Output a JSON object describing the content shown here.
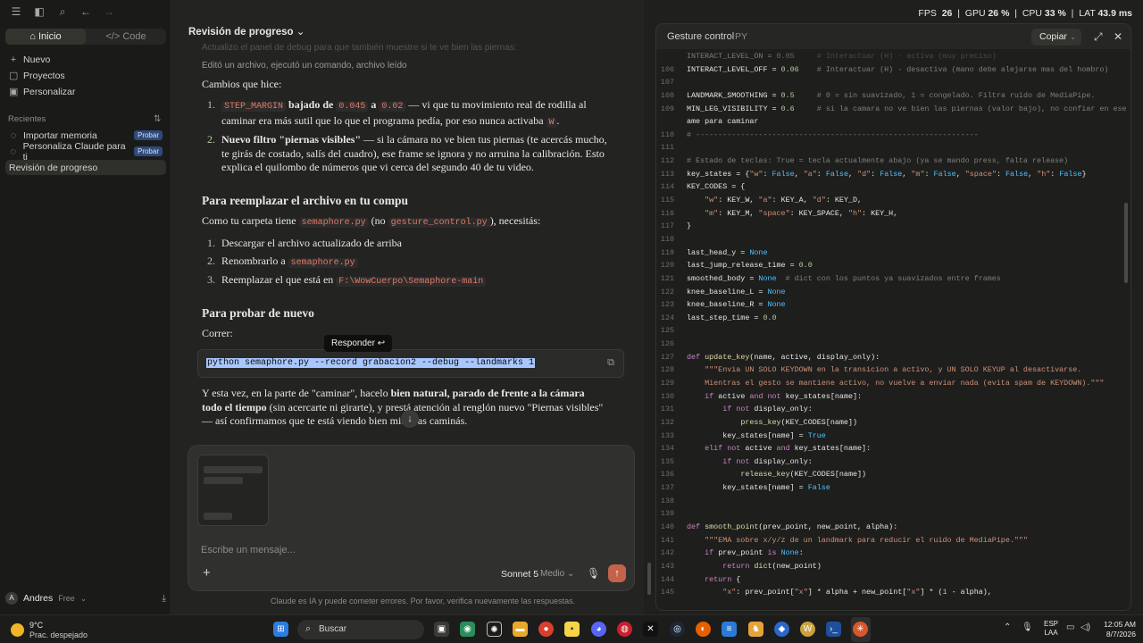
{
  "sidebar": {
    "modes": [
      "Inicio",
      "Code"
    ],
    "nav": [
      {
        "label": "Nuevo",
        "icon": "+"
      },
      {
        "label": "Proyectos",
        "icon": "▢"
      },
      {
        "label": "Personalizar",
        "icon": "▣"
      }
    ],
    "recents_title": "Recientes",
    "recents": [
      {
        "label": "Importar memoria",
        "badge": "Probar"
      },
      {
        "label": "Personaliza Claude para ti",
        "badge": "Probar"
      },
      {
        "label": "Revisión de progreso",
        "badge": ""
      }
    ],
    "user": {
      "initial": "A",
      "name": "Andres",
      "plan": "Free"
    }
  },
  "chat": {
    "title": "Revisión de progreso",
    "faded_top": "Actualizo el panel de debug para que también muestre si te ve bien las piernas:",
    "meta": "Editó un archivo, ejecutó un comando, archivo leído",
    "changes_heading": "Cambios que hice:",
    "change1": {
      "code1": "STEP_MARGIN",
      "b1": "bajado de",
      "code2": "0.045",
      "a": "a",
      "code3": "0.02",
      "rest": "— vi que tu movimiento real de rodilla al caminar era más sutil que lo que el programa pedía, por eso nunca activaba",
      "code4": "W",
      "end": "."
    },
    "change2": {
      "bold": "Nuevo filtro \"piernas visibles\"",
      "rest": "— si la cámara no ve bien tus piernas (te acercás mucho, te girás de costado, salís del cuadro), ese frame se ignora y no arruina la calibración. Esto explica el quilombo de números que vi cerca del segundo 40 de tu video."
    },
    "replace_heading": "Para reemplazar el archivo en tu compu",
    "replace_intro_a": "Como tu carpeta tiene",
    "replace_code1": "semaphore.py",
    "replace_intro_b": "(no",
    "replace_code2": "gesture_control.py",
    "replace_intro_c": "), necesitás:",
    "steps": [
      {
        "text": "Descargar el archivo actualizado de arriba",
        "code": "",
        "tail": ""
      },
      {
        "text": "Renombrarlo a",
        "code": "semaphore.py",
        "tail": ""
      },
      {
        "text": "Reemplazar el que está en",
        "code": "F:\\WowCuerpo\\Semaphore-main",
        "tail": ""
      }
    ],
    "test_heading": "Para probar de nuevo",
    "run_label": "Correr:",
    "tooltip": "Responder ↩",
    "command": "python semaphore.py --record grabacion2 --debug --landmarks 1",
    "final_a": "Y esta vez, en la parte de \"caminar\", hacelo",
    "final_bold": "bien natural, parado de frente a la cámara todo el tiempo",
    "final_b": "(sin acercarte ni girarte), y prestá atención al renglón nuevo \"Piernas visibles\" — así confirmamos que te está viendo bien mientras caminás."
  },
  "composer": {
    "placeholder": "Escribe un mensaje...",
    "model": "Sonnet 5",
    "effort": "Medio",
    "disclaimer": "Claude es IA y puede cometer errores. Por favor, verifica nuevamente las respuestas."
  },
  "panel": {
    "title": "Gesture control",
    "lang": "PY",
    "copy_label": "Copiar",
    "lines": [
      {
        "n": "",
        "code": "INTERACT_LEVEL_ON = 0.05     # Interactuar (H) - activa (muy preciso)"
      },
      {
        "n": "106",
        "code": "INTERACT_LEVEL_OFF = 0.06    # Interactuar (H) - desactiva (mano debe alejarse mas del hombro)"
      },
      {
        "n": "107",
        "code": ""
      },
      {
        "n": "108",
        "code": "LANDMARK_SMOOTHING = 0.5     # 0 = sin suavizado, 1 = congelado. Filtra ruido de MediaPipe."
      },
      {
        "n": "109",
        "code": "MIN_LEG_VISIBILITY = 0.6     # si la camara no ve bien las piernas (valor bajo), no confiar en ese fr"
      },
      {
        "n": "",
        "code": "ame para caminar"
      },
      {
        "n": "110",
        "code": "# ---------------------------------------------------------------"
      },
      {
        "n": "111",
        "code": ""
      },
      {
        "n": "112",
        "code": "# Estado de teclas: True = tecla actualmente abajo (ya se mando press, falta release)"
      },
      {
        "n": "113",
        "code": "key_states = {\"w\": False, \"a\": False, \"d\": False, \"m\": False, \"space\": False, \"h\": False}"
      },
      {
        "n": "114",
        "code": "KEY_CODES = {"
      },
      {
        "n": "115",
        "code": "    \"w\": KEY_W, \"a\": KEY_A, \"d\": KEY_D,"
      },
      {
        "n": "116",
        "code": "    \"m\": KEY_M, \"space\": KEY_SPACE, \"h\": KEY_H,"
      },
      {
        "n": "117",
        "code": "}"
      },
      {
        "n": "118",
        "code": ""
      },
      {
        "n": "119",
        "code": "last_head_y = None"
      },
      {
        "n": "120",
        "code": "last_jump_release_time = 0.0"
      },
      {
        "n": "121",
        "code": "smoothed_body = None  # dict con los puntos ya suavizados entre frames"
      },
      {
        "n": "122",
        "code": "knee_baseline_L = None"
      },
      {
        "n": "123",
        "code": "knee_baseline_R = None"
      },
      {
        "n": "124",
        "code": "last_step_time = 0.0"
      },
      {
        "n": "125",
        "code": ""
      },
      {
        "n": "126",
        "code": ""
      },
      {
        "n": "127",
        "code": "def update_key(name, active, display_only):"
      },
      {
        "n": "128",
        "code": "    \"\"\"Envia UN SOLO KEYDOWN en la transicion a activo, y UN SOLO KEYUP al desactivarse."
      },
      {
        "n": "129",
        "code": "    Mientras el gesto se mantiene activo, no vuelve a enviar nada (evita spam de KEYDOWN).\"\"\""
      },
      {
        "n": "130",
        "code": "    if active and not key_states[name]:"
      },
      {
        "n": "131",
        "code": "        if not display_only:"
      },
      {
        "n": "132",
        "code": "            press_key(KEY_CODES[name])"
      },
      {
        "n": "133",
        "code": "        key_states[name] = True"
      },
      {
        "n": "134",
        "code": "    elif not active and key_states[name]:"
      },
      {
        "n": "135",
        "code": "        if not display_only:"
      },
      {
        "n": "136",
        "code": "            release_key(KEY_CODES[name])"
      },
      {
        "n": "137",
        "code": "        key_states[name] = False"
      },
      {
        "n": "138",
        "code": ""
      },
      {
        "n": "139",
        "code": ""
      },
      {
        "n": "140",
        "code": "def smooth_point(prev_point, new_point, alpha):"
      },
      {
        "n": "141",
        "code": "    \"\"\"EMA sobre x/y/z de un landmark para reducir el ruido de MediaPipe.\"\"\""
      },
      {
        "n": "142",
        "code": "    if prev_point is None:"
      },
      {
        "n": "143",
        "code": "        return dict(new_point)"
      },
      {
        "n": "144",
        "code": "    return {"
      },
      {
        "n": "145",
        "code": "        \"x\": prev_point[\"x\"] * alpha + new_point[\"x\"] * (1 - alpha),"
      }
    ]
  },
  "stats": {
    "fps_label": "FPS",
    "fps": "26",
    "gpu_label": "GPU",
    "gpu": "26 %",
    "cpu_label": "CPU",
    "cpu": "33 %",
    "lat_label": "LAT",
    "lat": "43.9 ms"
  },
  "taskbar": {
    "temp": "9°C",
    "weather": "Prac. despejado",
    "search": "Buscar",
    "lang1": "ESP",
    "lang2": "LAA",
    "time": "12:05 AM",
    "date": "8/7/2026"
  },
  "colors": {
    "accent": "#c5624b",
    "badge": "#2f4a78",
    "selection": "#a9c7ff"
  }
}
